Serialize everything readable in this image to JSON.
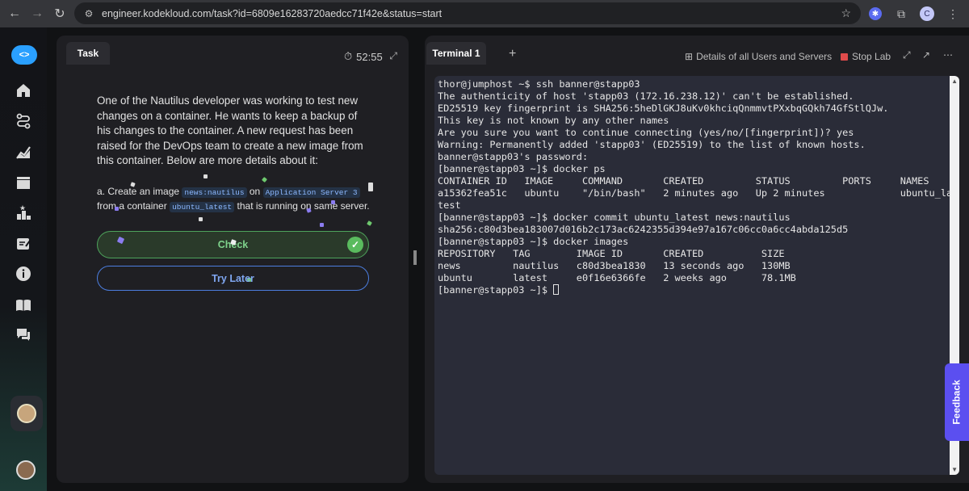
{
  "browser": {
    "url": "engineer.kodekloud.com/task?id=6809e16283720aedcc71f42e&status=start",
    "profile_initial": "C"
  },
  "task_panel": {
    "tab_label": "Task",
    "timer": "52:55",
    "description": "One of the Nautilus developer was working to test new changes on a container. He wants to keep a backup of his changes to the container. A new request has been raised for the DevOps team to create a new image from this container. Below are more details about it:",
    "detail": {
      "prefix": "a. Create an image",
      "image_chip": "news:nautilus",
      "on": "on",
      "server_chip": "Application Server 3",
      "from": "from",
      "container_prefix": "a container",
      "container_chip": "ubuntu_latest",
      "suffix": "that is running on same server."
    },
    "check_label": "Check",
    "try_later_label": "Try Later"
  },
  "terminal": {
    "tab_label": "Terminal 1",
    "details_link": "Details of all Users and Servers",
    "stop_lab": "Stop Lab",
    "lines": [
      "thor@jumphost ~$ ssh banner@stapp03",
      "The authenticity of host 'stapp03 (172.16.238.12)' can't be established.",
      "ED25519 key fingerprint is SHA256:5heDlGKJ8uKv0khciqQnmmvtPXxbqGQkh74GfStlQJw.",
      "This key is not known by any other names",
      "Are you sure you want to continue connecting (yes/no/[fingerprint])? yes",
      "Warning: Permanently added 'stapp03' (ED25519) to the list of known hosts.",
      "banner@stapp03's password:",
      "[banner@stapp03 ~]$ docker ps",
      "CONTAINER ID   IMAGE     COMMAND       CREATED         STATUS         PORTS     NAMES",
      "a15362fea51c   ubuntu    \"/bin/bash\"   2 minutes ago   Up 2 minutes             ubuntu_la",
      "test",
      "[banner@stapp03 ~]$ docker commit ubuntu_latest news:nautilus",
      "sha256:c80d3bea183007d016b2c173ac6242355d394e97a167c06cc0a6cc4abda125d5",
      "[banner@stapp03 ~]$ docker images",
      "REPOSITORY   TAG        IMAGE ID       CREATED          SIZE",
      "news         nautilus   c80d3bea1830   13 seconds ago   130MB",
      "ubuntu       latest     e0f16e6366fe   2 weeks ago      78.1MB",
      "[banner@stapp03 ~]$ "
    ]
  },
  "feedback_label": "Feedback"
}
